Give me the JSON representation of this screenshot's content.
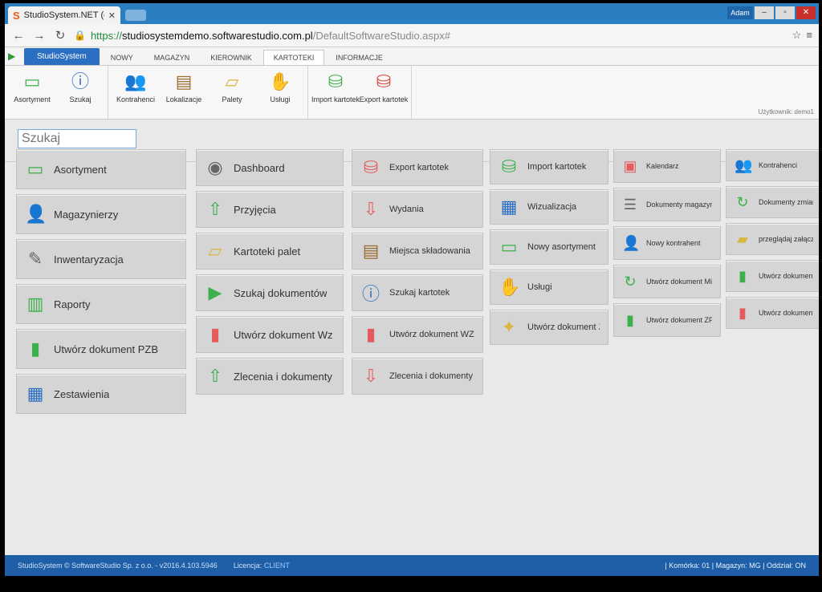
{
  "browser": {
    "tab_title": "StudioSystem.NET (c) Sof",
    "url_scheme": "https://",
    "url_host": "studiosystemdemo.softwarestudio.com.pl",
    "url_path": "/DefaultSoftwareStudio.aspx#",
    "user_badge": "Adam"
  },
  "ribbon": {
    "app_tab": "StudioSystem",
    "tabs": [
      "NOWY",
      "MAGAZYN",
      "KIEROWNIK",
      "KARTOTEKI",
      "INFORMACJE"
    ],
    "active_tab": "KARTOTEKI",
    "groups": [
      [
        {
          "label": "Asortyment",
          "icon": "product-box-icon"
        },
        {
          "label": "Szukaj",
          "icon": "search-info-icon"
        }
      ],
      [
        {
          "label": "Kontrahenci",
          "icon": "contractors-icon"
        },
        {
          "label": "Lokalizacje",
          "icon": "shelf-icon"
        },
        {
          "label": "Palety",
          "icon": "pallet-icon"
        },
        {
          "label": "Usługi",
          "icon": "service-hand-icon"
        }
      ],
      [
        {
          "label": "Import kartotek",
          "icon": "import-db-icon"
        },
        {
          "label": "Export kartotek",
          "icon": "export-db-icon"
        }
      ]
    ],
    "user_hint": "Użytkownik: demo1"
  },
  "search": {
    "placeholder": "Szukaj"
  },
  "tiles": {
    "col1": [
      {
        "label": "Asortyment",
        "icon": "product-box-icon"
      },
      {
        "label": "Magazynierzy",
        "icon": "warehouse-worker-icon"
      },
      {
        "label": "Inwentaryzacja",
        "icon": "inventory-doc-icon"
      },
      {
        "label": "Raporty",
        "icon": "report-chart-icon"
      },
      {
        "label": "Utwórz dokument PZB",
        "icon": "green-doc-icon"
      },
      {
        "label": "Zestawienia",
        "icon": "calendar-grid-icon"
      }
    ],
    "col2": [
      {
        "label": "Dashboard",
        "icon": "dashboard-gauge-icon"
      },
      {
        "label": "Przyjęcia",
        "icon": "doc-arrow-up-icon"
      },
      {
        "label": "Kartoteki palet",
        "icon": "pallet-icon"
      },
      {
        "label": "Szukaj dokumentów",
        "icon": "search-docs-icon"
      },
      {
        "label": "Utwórz dokument Wz",
        "icon": "red-doc-icon"
      },
      {
        "label": "Zlecenia i dokumenty przy",
        "icon": "doc-arrow-up-icon"
      }
    ],
    "col3": [
      {
        "label": "Export kartotek",
        "icon": "export-db-icon"
      },
      {
        "label": "Wydania",
        "icon": "doc-arrow-down-icon"
      },
      {
        "label": "Miejsca składowania",
        "icon": "shelf-icon"
      },
      {
        "label": "Szukaj kartotek",
        "icon": "search-info-icon"
      },
      {
        "label": "Utwórz dokument WZB",
        "icon": "red-doc-icon"
      },
      {
        "label": "Zlecenia i dokumenty wyda",
        "icon": "doc-arrow-down-icon"
      }
    ],
    "col4": [
      {
        "label": "Import kartotek",
        "icon": "import-db-icon"
      },
      {
        "label": "Wizualizacja",
        "icon": "grid-visual-icon"
      },
      {
        "label": "Nowy asortyment",
        "icon": "product-box-icon"
      },
      {
        "label": "Usługi",
        "icon": "service-hand-icon"
      },
      {
        "label": "Utwórz dokument ZL",
        "icon": "doc-star-icon"
      }
    ],
    "col5": [
      {
        "label": "Kalendarz",
        "icon": "calendar-icon"
      },
      {
        "label": "Dokumenty magazynowe",
        "icon": "doc-list-icon"
      },
      {
        "label": "Nowy kontrahent",
        "icon": "new-contractor-icon"
      },
      {
        "label": "Utwórz dokument Mix",
        "icon": "doc-cycle-icon"
      },
      {
        "label": "Utwórz dokument ZPZ",
        "icon": "green-doc-icon"
      }
    ],
    "col6": [
      {
        "label": "Kontrahenci",
        "icon": "contractors-icon"
      },
      {
        "label": "Dokumenty zmiany lokaliza",
        "icon": "doc-cycle-icon"
      },
      {
        "label": "przeglądaj załączniki",
        "icon": "folder-icon"
      },
      {
        "label": "Utwórz dokument Pz",
        "icon": "green-doc-icon"
      },
      {
        "label": "Utwórz dokument ZWZ",
        "icon": "red-doc-icon"
      }
    ]
  },
  "footer": {
    "copyright": "StudioSystem © SoftwareStudio Sp. z o.o. - v2016.4.103.5946",
    "license_label": "Licencja:",
    "license_value": "CLIENT",
    "status": "| Komórka: 01 | Magazyn: MG | Oddział: ON"
  },
  "colors": {
    "accent": "#2b6fc2",
    "footer": "#1f5fa8",
    "tile": "#d5d5d5"
  }
}
